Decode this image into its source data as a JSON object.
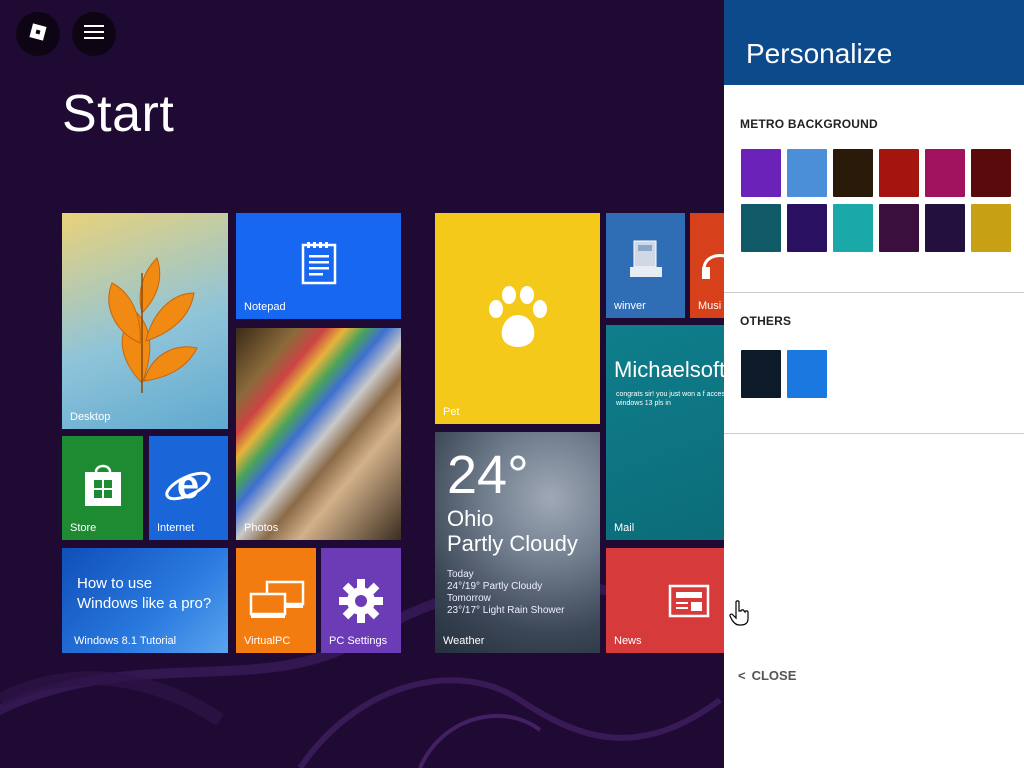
{
  "start": {
    "title": "Start"
  },
  "top_buttons": {
    "roblox_icon": "roblox-icon",
    "menu_icon": "hamburger-icon"
  },
  "tiles": {
    "desktop": {
      "label": "Desktop"
    },
    "notepad": {
      "label": "Notepad"
    },
    "photos": {
      "label": "Photos"
    },
    "store": {
      "label": "Store"
    },
    "internet": {
      "label": "Internet"
    },
    "tutorial": {
      "text_line1": "How to use",
      "text_line2": "Windows like a pro?",
      "label": "Windows 8.1 Tutorial"
    },
    "virtualpc": {
      "label": "VirtualPC"
    },
    "pcsettings": {
      "label": "PC Settings"
    },
    "pet": {
      "label": "Pet"
    },
    "weather": {
      "temperature": "24°",
      "city": "Ohio",
      "condition": "Partly Cloudy",
      "today_label": "Today",
      "today_forecast": "24°/19° Partly Cloudy",
      "tomorrow_label": "Tomorrow",
      "tomorrow_forecast": "23°/17° Light Rain Shower",
      "label": "Weather"
    },
    "winver": {
      "label": "winver"
    },
    "music": {
      "label": "Musi"
    },
    "mail": {
      "title": "Michaelsoft",
      "snippet": "congrats sir! you just won a f access to windows 13 pls in",
      "label": "Mail"
    },
    "news": {
      "label": "News"
    }
  },
  "panel": {
    "title": "Personalize",
    "metro_label": "METRO BACKGROUND",
    "metro_swatches": [
      "#6a22b8",
      "#4a8fd8",
      "#2a1a0a",
      "#a5150f",
      "#a0125e",
      "#5a0a0a",
      "#0f5a66",
      "#2a1060",
      "#1aa8a8",
      "#3a0f3e",
      "#24103e",
      "#c8a014"
    ],
    "others_label": "OTHERS",
    "other_swatches": [
      "#0c1a2a",
      "#1a78e0"
    ],
    "close_label": "CLOSE"
  },
  "colors": {
    "panel_header": "#0d4a8c",
    "background": "#1f0a33"
  }
}
